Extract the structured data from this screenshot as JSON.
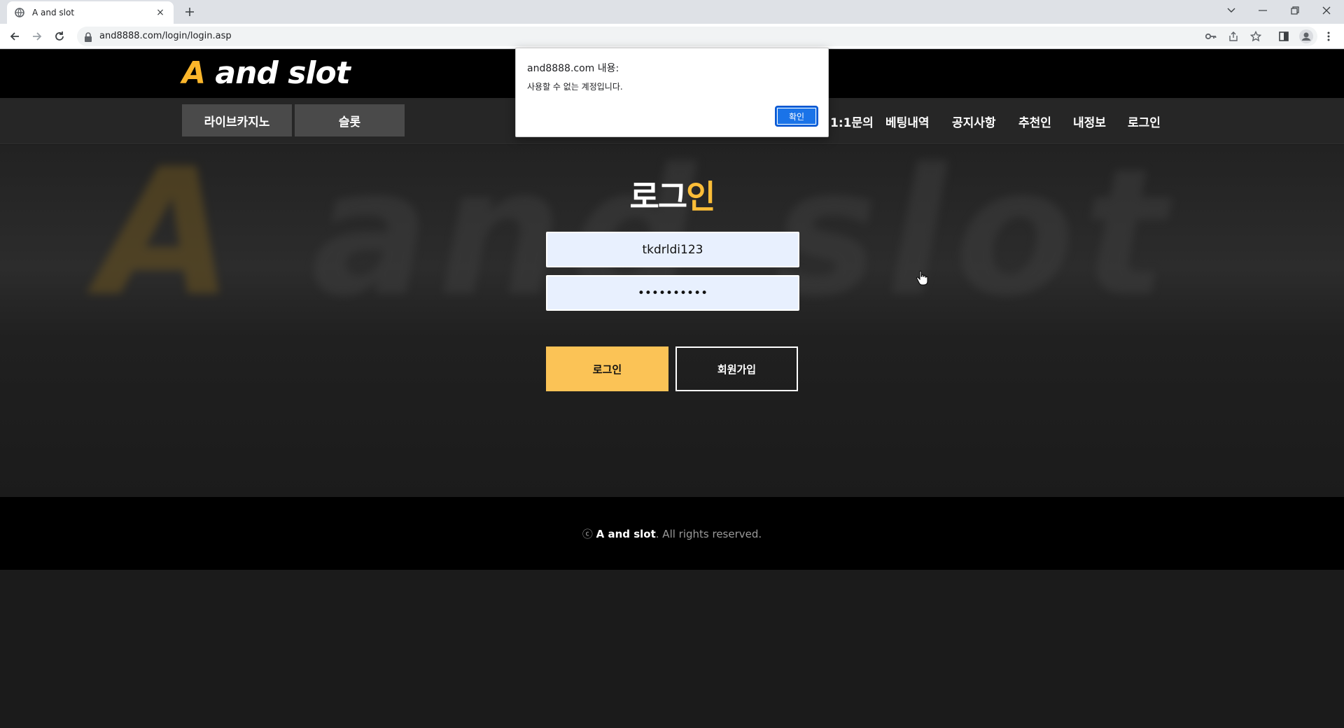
{
  "browser": {
    "tab_title": "A and slot",
    "tab_close": "×",
    "new_tab": "+",
    "url": "and8888.com/login/login.asp"
  },
  "site": {
    "logo_a": "A",
    "logo_rest": " and slot",
    "brand_accent_color": "#fbb62b"
  },
  "nav": {
    "tabs": [
      "라이브카지노",
      "슬롯"
    ],
    "links": [
      "1:1문의",
      "베팅내역",
      "공지사항",
      "추천인",
      "내정보",
      "로그인"
    ]
  },
  "login": {
    "title_main": "로그",
    "title_highlight": "인",
    "username_value": "tkdrldi123",
    "password_value": "••••••••••",
    "login_button": "로그인",
    "join_button": "회원가입"
  },
  "footer": {
    "copyright_symbol": "ⓒ",
    "brand": "A and slot",
    "rights": ". All rights reserved."
  },
  "dialog": {
    "title": "and8888.com 내용:",
    "message": "사용할 수 없는 계정입니다.",
    "ok_button": "확인"
  }
}
